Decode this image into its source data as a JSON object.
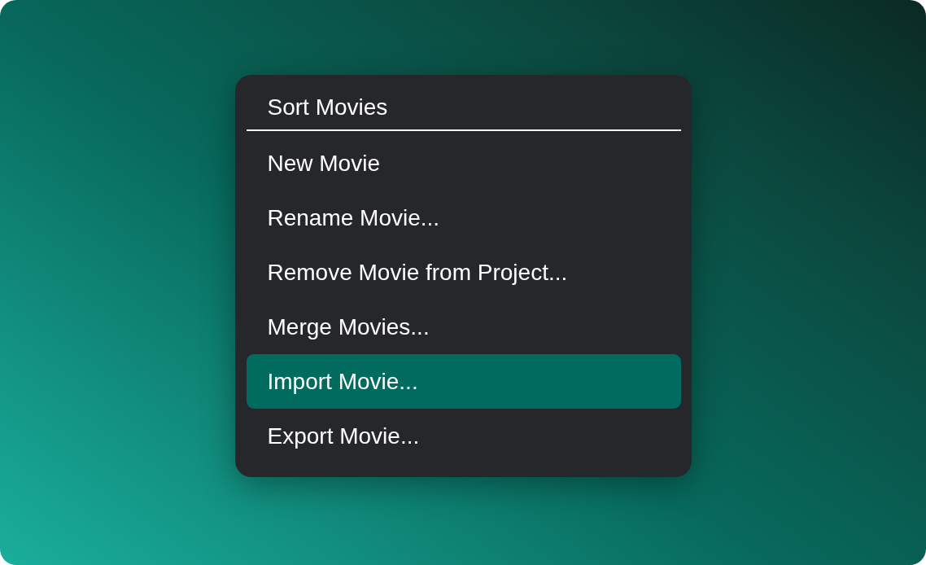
{
  "menu": {
    "title": "Sort Movies",
    "items": [
      {
        "label": "New Movie",
        "selected": false
      },
      {
        "label": "Rename Movie...",
        "selected": false
      },
      {
        "label": "Remove Movie from Project...",
        "selected": false
      },
      {
        "label": "Merge Movies...",
        "selected": false
      },
      {
        "label": "Import Movie...",
        "selected": true
      },
      {
        "label": "Export Movie...",
        "selected": false
      }
    ]
  }
}
